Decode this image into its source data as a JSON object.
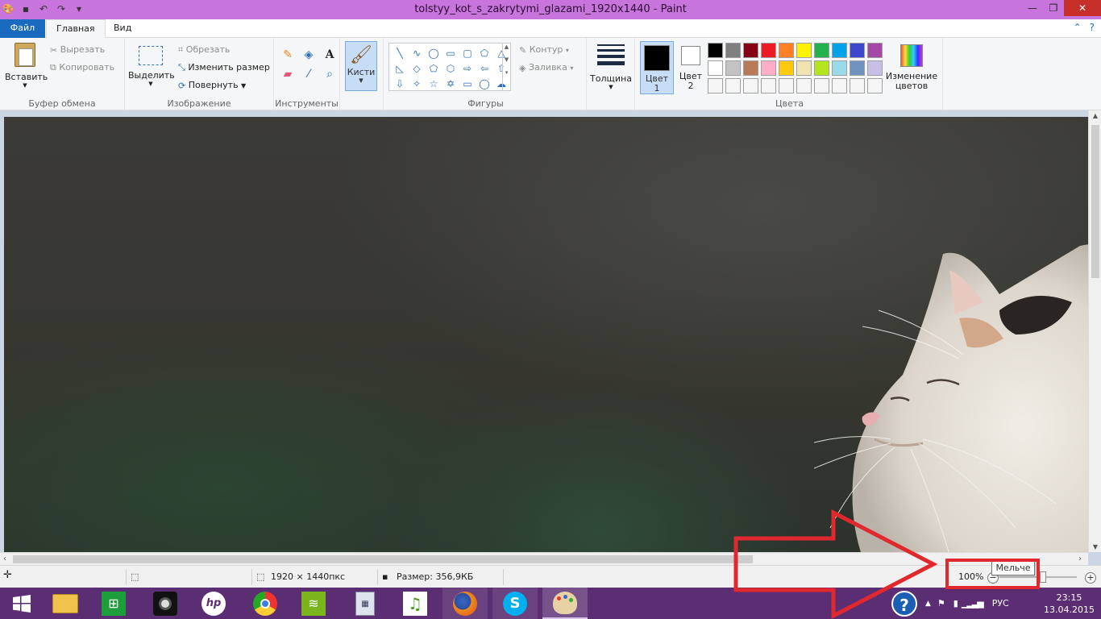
{
  "window": {
    "title": "tolstyy_kot_s_zakrytymi_glazami_1920x1440 - Paint"
  },
  "tabs": [
    {
      "label": "Файл"
    },
    {
      "label": "Главная"
    },
    {
      "label": "Вид"
    }
  ],
  "ribbon": {
    "clipboard": {
      "paste_label": "Вставить",
      "cut_label": "Вырезать",
      "copy_label": "Копировать",
      "group_label": "Буфер обмена"
    },
    "image": {
      "select_label": "Выделить",
      "crop_label": "Обрезать",
      "resize_label": "Изменить размер",
      "rotate_label": "Повернуть",
      "group_label": "Изображение"
    },
    "tools": {
      "group_label": "Инструменты"
    },
    "brushes": {
      "label": "Кисти"
    },
    "shapes": {
      "outline_label": "Контур",
      "fill_label": "Заливка",
      "group_label": "Фигуры"
    },
    "size": {
      "label": "Толщина"
    },
    "colors": {
      "color1_label_line1": "Цвет",
      "color1_label_line2": "1",
      "color2_label_line1": "Цвет",
      "color2_label_line2": "2",
      "edit_label_line1": "Изменение",
      "edit_label_line2": "цветов",
      "group_label": "Цвета",
      "color1": "#000000",
      "color2": "#ffffff",
      "palette": [
        "#000000",
        "#7f7f7f",
        "#880015",
        "#ed1c24",
        "#ff7f27",
        "#fff200",
        "#22b14c",
        "#00a2e8",
        "#3f48cc",
        "#a349a4",
        "#ffffff",
        "#c3c3c3",
        "#b97a57",
        "#ffaec9",
        "#ffc90e",
        "#efe4b0",
        "#b5e61d",
        "#99d9ea",
        "#7092be",
        "#c8bfe7",
        "#f5f5f5",
        "#f5f5f5",
        "#f5f5f5",
        "#f5f5f5",
        "#f5f5f5",
        "#f5f5f5",
        "#f5f5f5",
        "#f5f5f5",
        "#f5f5f5",
        "#f5f5f5"
      ]
    }
  },
  "statusbar": {
    "dimensions": "1920 × 1440пкс",
    "size": "Размер: 356,9КБ",
    "zoom": "100%",
    "tooltip": "Мельче"
  },
  "taskbar": {
    "apps": [
      "start",
      "explorer",
      "store",
      "webcam",
      "hp",
      "chrome",
      "wifi",
      "calculator",
      "music",
      "firefox",
      "skype",
      "paint"
    ],
    "language": "РУС",
    "time": "23:15",
    "date": "13.04.2015"
  },
  "colors": {
    "titlebar": "#c775dc",
    "taskbar": "#5b2d72",
    "file_tab": "#1a6bc0",
    "annotation": "#e0282e"
  }
}
